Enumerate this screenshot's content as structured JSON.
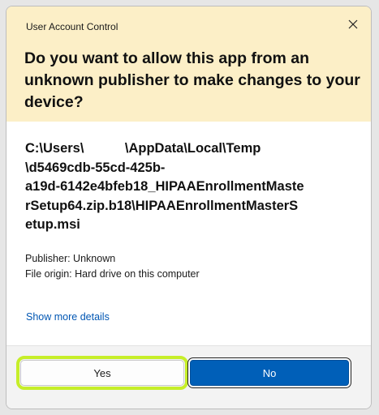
{
  "dialog": {
    "title": "User Account Control",
    "question": "Do you want to allow this app from an unknown publisher to make changes to your device?",
    "path": "C:\\Users\\           \\AppData\\Local\\Temp\n\\d5469cdb-55cd-425b-\na19d-6142e4bfeb18_HIPAAEnrollmentMaste\nrSetup64.zip.b18\\HIPAAEnrollmentMasterS\netup.msi",
    "publisher": "Publisher: Unknown",
    "file_origin": "File origin: Hard drive on this computer",
    "show_more_details": "Show more details",
    "close_icon": "close-icon"
  },
  "buttons": {
    "yes_label": "Yes",
    "no_label": "No"
  },
  "colors": {
    "header_bg": "#fcefc7",
    "link": "#0056b3",
    "primary_button": "#005fb8",
    "highlight_outline": "#c6ee29"
  }
}
